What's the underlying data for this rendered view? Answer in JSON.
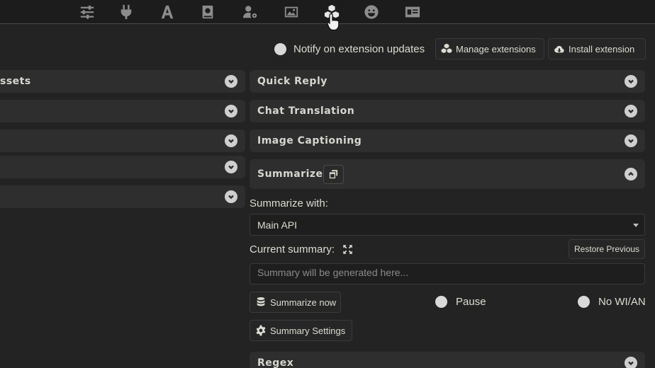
{
  "nav": {
    "icons": [
      "sliders-icon",
      "plug-icon",
      "font-icon",
      "book-icon",
      "user-gear-icon",
      "image-icon",
      "cubes-icon",
      "smile-icon",
      "id-card-icon"
    ],
    "active": "cubes-icon"
  },
  "extensions": {
    "notify_label": "Notify on extension updates",
    "manage_label": "Manage extensions",
    "install_label": "Install extension"
  },
  "left": {
    "first_drawer_title": "ssets"
  },
  "right": {
    "drawers": [
      {
        "title": "Quick Reply"
      },
      {
        "title": "Chat Translation"
      },
      {
        "title": "Image Captioning"
      }
    ],
    "summarize": {
      "title": "Summarize",
      "summarize_with_label": "Summarize with:",
      "summarize_with_value": "Main API",
      "current_summary_label": "Current summary:",
      "restore_label": "Restore Previous",
      "summary_placeholder": "Summary will be generated here...",
      "summarize_now_label": "Summarize now",
      "pause_label": "Pause",
      "no_wian_label": "No WI/AN",
      "settings_label": "Summary Settings"
    },
    "regex_title": "Regex"
  }
}
